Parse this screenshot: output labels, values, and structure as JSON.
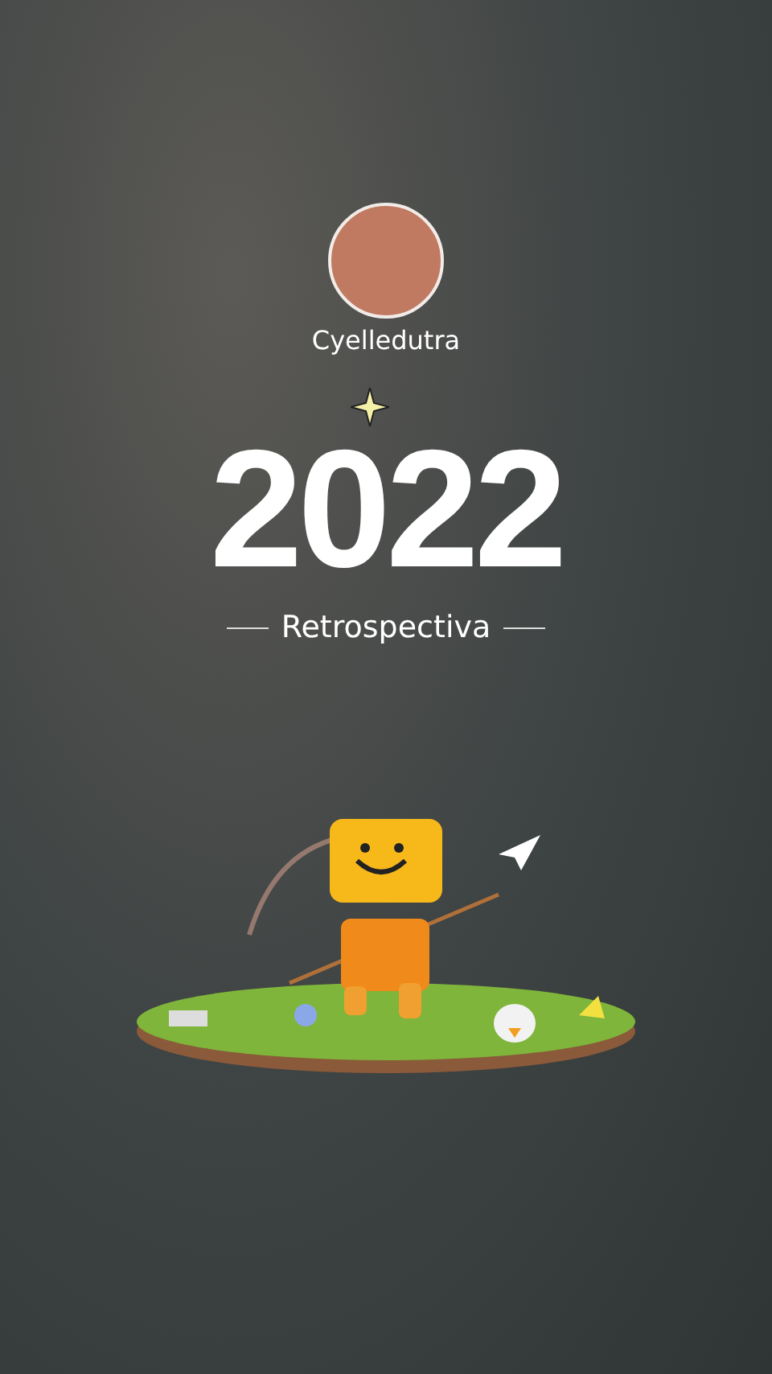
{
  "profile": {
    "username": "Cyelledutra"
  },
  "title": {
    "year": "2022",
    "subtitle": "Retrospectiva"
  }
}
